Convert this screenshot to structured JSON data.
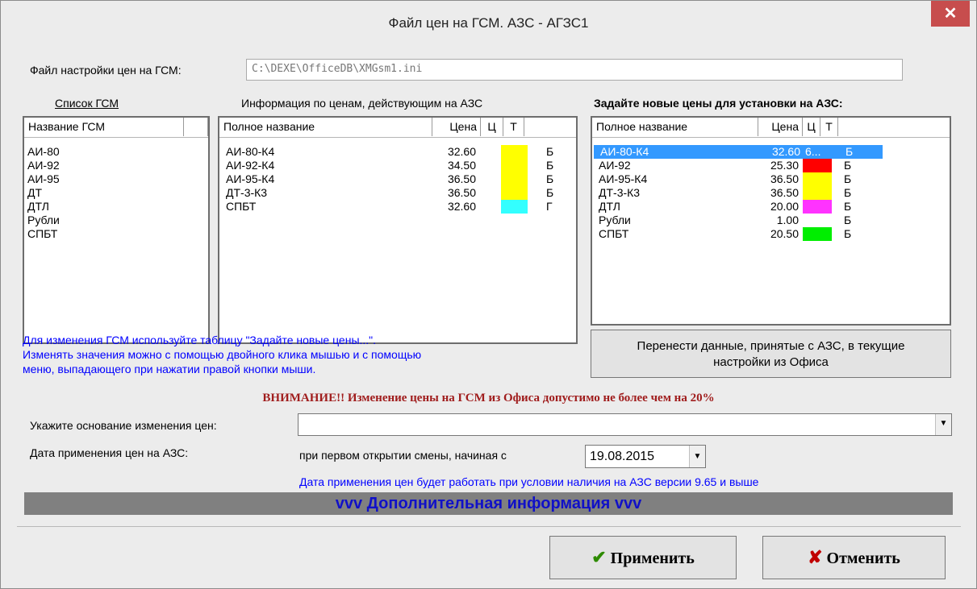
{
  "window": {
    "title": "Файл цен на ГСМ. АЗС - АГЗС1",
    "close_glyph": "✕"
  },
  "settings_file": {
    "label": "Файл настройки цен на ГСМ:",
    "value": "C:\\DEXE\\OfficeDB\\XMGsm1.ini"
  },
  "gsm_list": {
    "title": "Список ГСМ",
    "header": "Название ГСМ",
    "items": [
      "АИ-80",
      "АИ-92",
      "АИ-95",
      "ДТ",
      "ДТЛ",
      "Рубли",
      "СПБТ"
    ]
  },
  "current_prices": {
    "title": "Информация по ценам, действующим на АЗС",
    "headers": [
      "Полное название",
      "Цена",
      "Ц",
      "Т"
    ],
    "rows": [
      {
        "name": "АИ-80-К4",
        "price": "32.60",
        "color": "#ffff00",
        "type": "Б"
      },
      {
        "name": "АИ-92-К4",
        "price": "34.50",
        "color": "#ffff00",
        "type": "Б"
      },
      {
        "name": "АИ-95-К4",
        "price": "36.50",
        "color": "#ffff00",
        "type": "Б"
      },
      {
        "name": "ДТ-3-К3",
        "price": "36.50",
        "color": "#ffff00",
        "type": "Б"
      },
      {
        "name": "СПБТ",
        "price": "32.60",
        "color": "#33ffff",
        "type": "Г"
      }
    ]
  },
  "new_prices": {
    "title": "Задайте новые цены для установки на АЗС:",
    "headers": [
      "Полное название",
      "Цена",
      "Ц",
      "Т"
    ],
    "rows": [
      {
        "name": "АИ-80-К4",
        "price": "32.60",
        "color": "6...",
        "type": "Б",
        "selected": true
      },
      {
        "name": "АИ-92",
        "price": "25.30",
        "color": "#ff0000",
        "type": "Б"
      },
      {
        "name": "АИ-95-К4",
        "price": "36.50",
        "color": "#ffff00",
        "type": "Б"
      },
      {
        "name": "ДТ-3-К3",
        "price": "36.50",
        "color": "#ffff00",
        "type": "Б"
      },
      {
        "name": "ДТЛ",
        "price": "20.00",
        "color": "#ff33ff",
        "type": "Б"
      },
      {
        "name": "Рубли",
        "price": "1.00",
        "color": "",
        "type": "Б"
      },
      {
        "name": "СПБТ",
        "price": "20.50",
        "color": "#00ee00",
        "type": "Б"
      }
    ]
  },
  "hint": {
    "line1": "Для изменения ГСМ используйте таблицу \"Задайте новые цены...\".",
    "line2": "Изменять значения можно с помощью двойного клика мышью и с помощью",
    "line3": "меню, выпадающего при нажатии правой кнопки мыши."
  },
  "transfer_button": {
    "line1": "Перенести данные, принятые с АЗС, в текущие",
    "line2": "настройки из Офиса"
  },
  "warning": "ВНИМАНИЕ!! Изменение цены  на ГСМ из Офиса допустимо не более чем на 20%",
  "reason": {
    "label": "Укажите основание изменения цен:",
    "value": ""
  },
  "apply_date": {
    "label": "Дата применения цен на АЗС:",
    "mode_label": "при первом открытии смены, начиная с",
    "value": "19.08.2015",
    "note": "Дата применения цен будет работать при условии наличия на АЗС версии 9.65 и выше"
  },
  "more_info": "vvv  Дополнительная информация  vvv",
  "buttons": {
    "apply": "Применить",
    "cancel": "Отменить"
  },
  "icons": {
    "apply_icon": "check-icon",
    "cancel_icon": "x-icon",
    "dropdown_icon": "chevron-down-icon"
  },
  "colors": {
    "selection": "#3399ff",
    "hint_text": "#0000ff",
    "warning_text": "#a01d1d",
    "info_bar": "#808080"
  }
}
